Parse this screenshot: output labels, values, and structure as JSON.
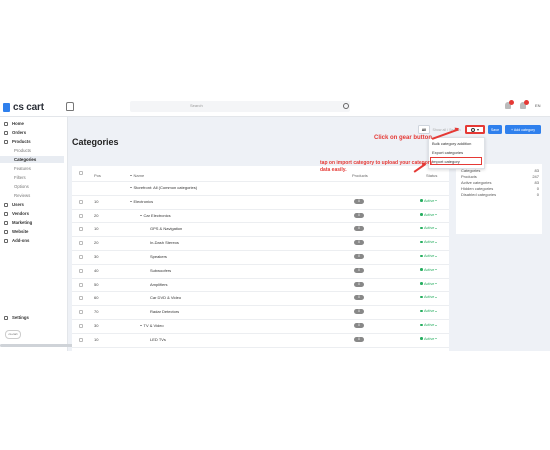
{
  "app": {
    "logo_text": "cs cart",
    "search_placeholder": "Search",
    "lang": "EN"
  },
  "sidebar": {
    "items": [
      {
        "label": "Home"
      },
      {
        "label": "Orders"
      },
      {
        "label": "Products"
      },
      {
        "label": "Products"
      },
      {
        "label": "Categories"
      },
      {
        "label": "Features"
      },
      {
        "label": "Filters"
      },
      {
        "label": "Options"
      },
      {
        "label": "Reviews"
      },
      {
        "label": "Users"
      },
      {
        "label": "Vendors"
      },
      {
        "label": "Marketing"
      },
      {
        "label": "Website"
      },
      {
        "label": "Add-ons"
      }
    ],
    "settings_label": "Settings",
    "footer_logo": "cs-cart"
  },
  "page": {
    "title": "Categories"
  },
  "toolbar": {
    "all_label": "All",
    "mid_label": "Show all / Search",
    "save_label": "Save",
    "add_label": "+ Add category"
  },
  "gear_menu": {
    "items": [
      "Bulk category addition",
      "Export categories",
      "Import category"
    ]
  },
  "annotations": {
    "gear": "Click on gear button",
    "import": "tap on import category to upload your category data easily."
  },
  "table": {
    "headers": {
      "pos": "Pos",
      "name": "Name",
      "products": "Products",
      "status": "Status"
    },
    "rows": [
      {
        "pos": "",
        "name": "Storefront: All (Common categories)",
        "products": "",
        "status": ""
      },
      {
        "pos": "10",
        "name": "Electronics",
        "products": "0",
        "status": "Active"
      },
      {
        "pos": "20",
        "name": "Car Electronics",
        "products": "0",
        "status": "Active"
      },
      {
        "pos": "10",
        "name": "GPS & Navigation",
        "products": "0",
        "status": "Active"
      },
      {
        "pos": "20",
        "name": "In-Dash Stereos",
        "products": "0",
        "status": "Active"
      },
      {
        "pos": "30",
        "name": "Speakers",
        "products": "0",
        "status": "Active"
      },
      {
        "pos": "40",
        "name": "Subwoofers",
        "products": "0",
        "status": "Active"
      },
      {
        "pos": "50",
        "name": "Amplifiers",
        "products": "0",
        "status": "Active"
      },
      {
        "pos": "60",
        "name": "Car DVD & Video",
        "products": "0",
        "status": "Active"
      },
      {
        "pos": "70",
        "name": "Radar Detectors",
        "products": "0",
        "status": "Active"
      },
      {
        "pos": "30",
        "name": "TV & Video",
        "products": "0",
        "status": "Active"
      },
      {
        "pos": "10",
        "name": "LED TVs",
        "products": "0",
        "status": "Active"
      }
    ]
  },
  "stats": [
    {
      "label": "Categories",
      "value": "83"
    },
    {
      "label": "Products",
      "value": "247"
    },
    {
      "label": "Active categories",
      "value": "83"
    },
    {
      "label": "Hidden categories",
      "value": "0"
    },
    {
      "label": "Disabled categories",
      "value": "0"
    }
  ]
}
